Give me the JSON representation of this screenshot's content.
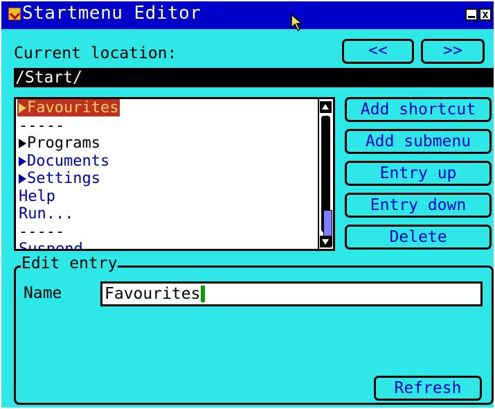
{
  "window": {
    "title": "Startmenu Editor",
    "close_glyph": "x"
  },
  "location": {
    "label": "Current location:",
    "path": "/Start/",
    "back_label": "<<",
    "forward_label": ">>"
  },
  "menu_list": {
    "items": [
      {
        "label": "Favourites",
        "submenu": true,
        "selected": true
      },
      {
        "label": "-----",
        "separator": true
      },
      {
        "label": "Programs",
        "submenu": true,
        "dark": true
      },
      {
        "label": "Documents",
        "submenu": true
      },
      {
        "label": "Settings",
        "submenu": true
      },
      {
        "label": "Help"
      },
      {
        "label": "Run..."
      },
      {
        "label": "-----",
        "separator": true
      },
      {
        "label": "Suspend"
      }
    ]
  },
  "actions": {
    "add_shortcut": "Add shortcut",
    "add_submenu": "Add submenu",
    "entry_up": "Entry up",
    "entry_down": "Entry down",
    "delete": "Delete"
  },
  "edit_entry": {
    "legend": "Edit entry",
    "name_label": "Name",
    "name_value": "Favourites",
    "refresh_label": "Refresh"
  },
  "colors": {
    "background": "#2ee8e8",
    "titlebar": "#0000c8",
    "selection": "#c03020",
    "button_text": "#0000c8"
  }
}
